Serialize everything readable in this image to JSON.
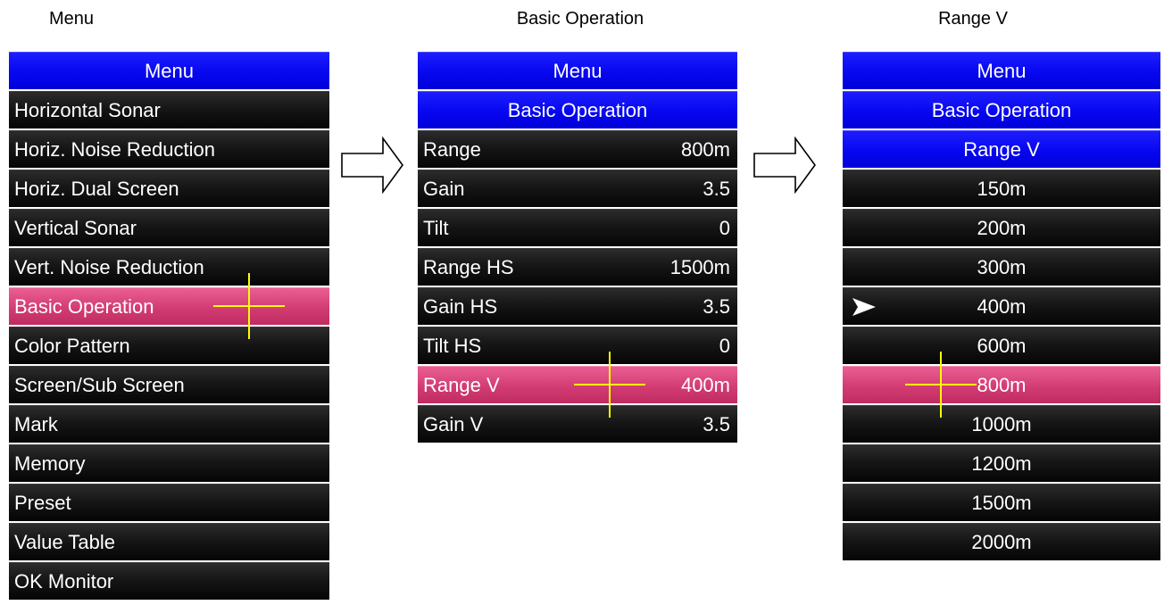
{
  "captions": {
    "menu": "Menu",
    "basic_operation": "Basic Operation",
    "range_v": "Range V"
  },
  "panel1": {
    "header": "Menu",
    "items": [
      {
        "label": "Horizontal Sonar"
      },
      {
        "label": "Horiz. Noise Reduction"
      },
      {
        "label": "Horiz. Dual Screen"
      },
      {
        "label": "Vertical Sonar"
      },
      {
        "label": "Vert. Noise Reduction"
      },
      {
        "label": "Basic Operation",
        "selected": true
      },
      {
        "label": "Color Pattern"
      },
      {
        "label": "Screen/Sub Screen"
      },
      {
        "label": "Mark"
      },
      {
        "label": "Memory"
      },
      {
        "label": "Preset"
      },
      {
        "label": "Value Table"
      },
      {
        "label": "OK Monitor"
      }
    ]
  },
  "panel2": {
    "headers": [
      "Menu",
      "Basic Operation"
    ],
    "items": [
      {
        "label": "Range",
        "value": "800m"
      },
      {
        "label": "Gain",
        "value": "3.5"
      },
      {
        "label": "Tilt",
        "value": "0"
      },
      {
        "label": "Range HS",
        "value": "1500m"
      },
      {
        "label": "Gain HS",
        "value": "3.5"
      },
      {
        "label": "Tilt HS",
        "value": "0"
      },
      {
        "label": "Range V",
        "value": "400m",
        "selected": true
      },
      {
        "label": "Gain V",
        "value": "3.5"
      }
    ]
  },
  "panel3": {
    "headers": [
      "Menu",
      "Basic Operation",
      "Range V"
    ],
    "options": [
      "150m",
      "200m",
      "300m",
      "400m",
      "600m",
      "800m",
      "1000m",
      "1200m",
      "1500m",
      "2000m"
    ],
    "current_value": "400m",
    "highlighted_value": "800m"
  },
  "colors": {
    "header_blue": "#0707f0",
    "selection_pink": "#d23c72",
    "cursor_yellow": "#ffff00",
    "row_black": "#111111"
  },
  "icons": {
    "transition_arrow": "right-arrow-outline",
    "current_value_pointer": "arrowhead-pointer",
    "cursor": "crosshair"
  }
}
